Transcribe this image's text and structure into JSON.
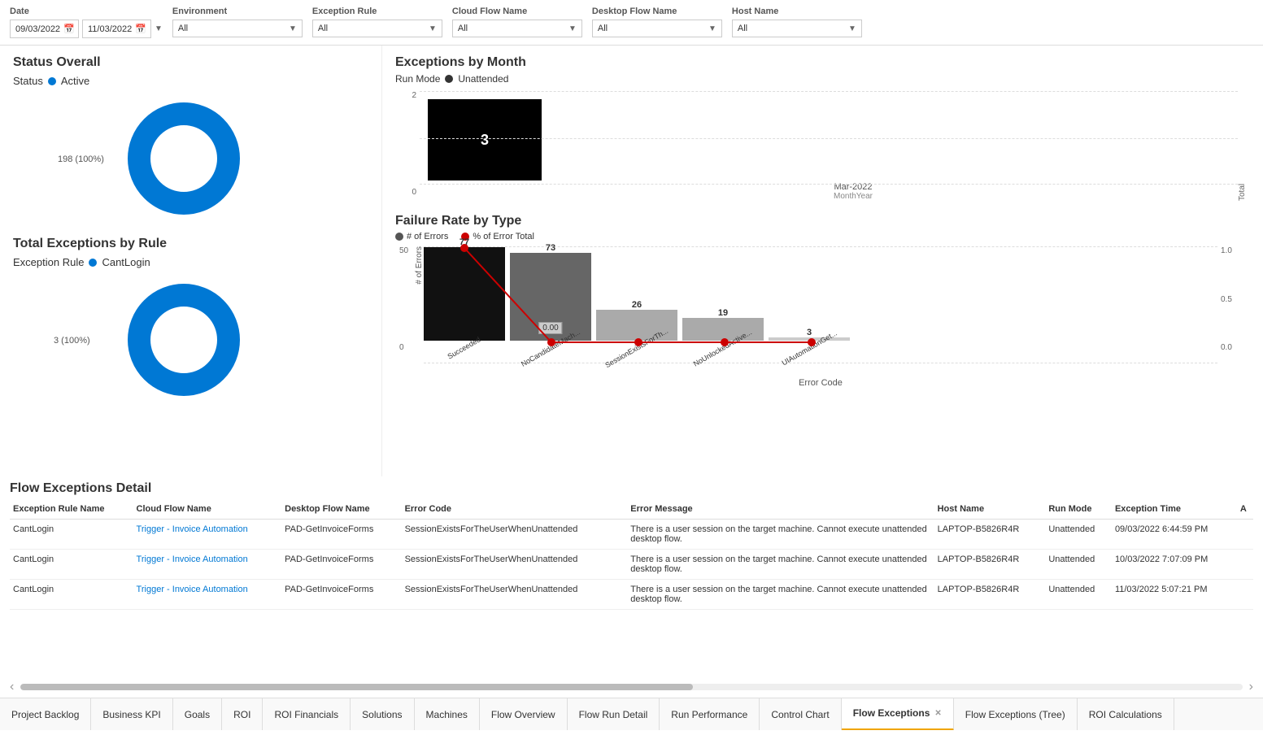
{
  "filters": {
    "date_label": "Date",
    "date_start": "09/03/2022",
    "date_end": "11/03/2022",
    "environment_label": "Environment",
    "environment_value": "All",
    "exception_rule_label": "Exception Rule",
    "exception_rule_value": "All",
    "cloud_flow_name_label": "Cloud Flow Name",
    "cloud_flow_name_value": "All",
    "desktop_flow_name_label": "Desktop Flow Name",
    "desktop_flow_name_value": "All",
    "host_name_label": "Host Name",
    "host_name_value": "All"
  },
  "status_overall": {
    "title": "Status Overall",
    "status_label": "Status",
    "status_value": "Active",
    "donut_label": "198 (100%)",
    "donut_value": 100
  },
  "total_exceptions": {
    "title": "Total Exceptions by Rule",
    "rule_label": "Exception Rule",
    "rule_value": "CantLogin",
    "donut_label": "3 (100%)",
    "donut_value": 100
  },
  "exceptions_by_month": {
    "title": "Exceptions by Month",
    "run_mode_label": "Run Mode",
    "run_mode_value": "Unattended",
    "x_label": "MonthYear",
    "y_label": "Total",
    "bars": [
      {
        "month": "Mar-2022",
        "value": 3,
        "highlighted": true
      }
    ],
    "y_max": 3,
    "y_ticks": [
      0,
      2
    ]
  },
  "failure_rate": {
    "title": "Failure Rate by Type",
    "legend": [
      {
        "key": "errors",
        "label": "# of Errors",
        "color": "#555"
      },
      {
        "key": "pct",
        "label": "% of Error Total",
        "color": "#cc0000"
      }
    ],
    "x_label": "Error Code",
    "y_left_label": "# of Errors",
    "bars": [
      {
        "code": "Succeeded",
        "errors": 77,
        "pct": null,
        "color": "#111",
        "label": "77"
      },
      {
        "code": "NoCandidateMach...",
        "errors": 73,
        "pct": 0.0,
        "color": "#666",
        "label": "73"
      },
      {
        "code": "SessionExistsForTh...",
        "errors": 26,
        "pct": null,
        "color": "#aaa",
        "label": "26"
      },
      {
        "code": "NoUnlockedActive...",
        "errors": 19,
        "pct": null,
        "color": "#aaa",
        "label": "19"
      },
      {
        "code": "UIAutomationGet...",
        "errors": 3,
        "pct": null,
        "color": "#ccc",
        "label": "3"
      }
    ]
  },
  "flow_exceptions_detail": {
    "title": "Flow Exceptions Detail",
    "columns": [
      "Exception Rule Name",
      "Cloud Flow Name",
      "Desktop Flow Name",
      "Error Code",
      "Error Message",
      "Host Name",
      "Run Mode",
      "Exception Time",
      "A"
    ],
    "rows": [
      {
        "exception_rule": "CantLogin",
        "cloud_flow": "Trigger - Invoice Automation",
        "desktop_flow": "PAD-GetInvoiceForms",
        "error_code": "SessionExistsForTheUserWhenUnattended",
        "error_message": "There is a user session on the target machine. Cannot execute unattended desktop flow.",
        "host_name": "LAPTOP-B5826R4R",
        "run_mode": "Unattended",
        "exception_time": "09/03/2022 6:44:59 PM"
      },
      {
        "exception_rule": "CantLogin",
        "cloud_flow": "Trigger - Invoice Automation",
        "desktop_flow": "PAD-GetInvoiceForms",
        "error_code": "SessionExistsForTheUserWhenUnattended",
        "error_message": "There is a user session on the target machine. Cannot execute unattended desktop flow.",
        "host_name": "LAPTOP-B5826R4R",
        "run_mode": "Unattended",
        "exception_time": "10/03/2022 7:07:09 PM"
      },
      {
        "exception_rule": "CantLogin",
        "cloud_flow": "Trigger - Invoice Automation",
        "desktop_flow": "PAD-GetInvoiceForms",
        "error_code": "SessionExistsForTheUserWhenUnattended",
        "error_message": "There is a user session on the target machine. Cannot execute unattended desktop flow.",
        "host_name": "LAPTOP-B5826R4R",
        "run_mode": "Unattended",
        "exception_time": "11/03/2022 5:07:21 PM"
      }
    ]
  },
  "tabs": [
    {
      "id": "project-backlog",
      "label": "Project Backlog",
      "active": false,
      "closable": false
    },
    {
      "id": "business-kpi",
      "label": "Business KPI",
      "active": false,
      "closable": false
    },
    {
      "id": "goals",
      "label": "Goals",
      "active": false,
      "closable": false
    },
    {
      "id": "roi",
      "label": "ROI",
      "active": false,
      "closable": false
    },
    {
      "id": "roi-financials",
      "label": "ROI Financials",
      "active": false,
      "closable": false
    },
    {
      "id": "solutions",
      "label": "Solutions",
      "active": false,
      "closable": false
    },
    {
      "id": "machines",
      "label": "Machines",
      "active": false,
      "closable": false
    },
    {
      "id": "flow-overview",
      "label": "Flow Overview",
      "active": false,
      "closable": false
    },
    {
      "id": "flow-run-detail",
      "label": "Flow Run Detail",
      "active": false,
      "closable": false
    },
    {
      "id": "run-performance",
      "label": "Run Performance",
      "active": false,
      "closable": false
    },
    {
      "id": "control-chart",
      "label": "Control Chart",
      "active": false,
      "closable": false
    },
    {
      "id": "flow-exceptions",
      "label": "Flow Exceptions",
      "active": true,
      "closable": true
    },
    {
      "id": "flow-exceptions-tree",
      "label": "Flow Exceptions (Tree)",
      "active": false,
      "closable": false
    },
    {
      "id": "roi-calculations",
      "label": "ROI Calculations",
      "active": false,
      "closable": false
    }
  ]
}
